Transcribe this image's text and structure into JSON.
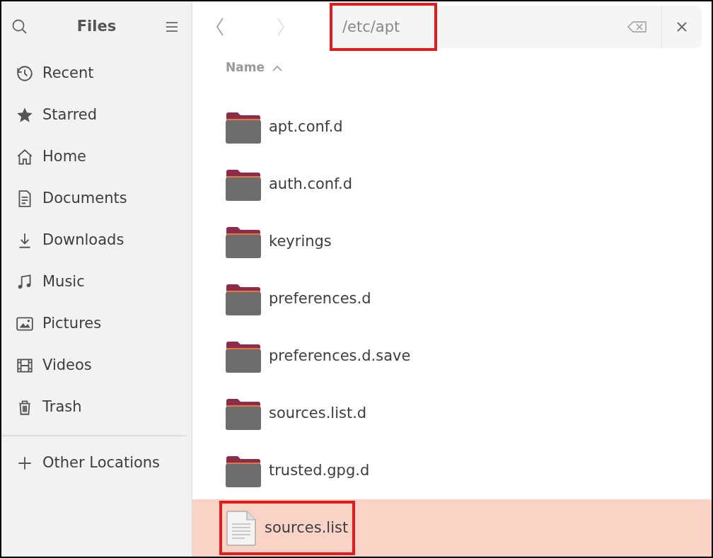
{
  "sidebar": {
    "title": "Files",
    "items": [
      {
        "label": "Recent"
      },
      {
        "label": "Starred"
      },
      {
        "label": "Home"
      },
      {
        "label": "Documents"
      },
      {
        "label": "Downloads"
      },
      {
        "label": "Music"
      },
      {
        "label": "Pictures"
      },
      {
        "label": "Videos"
      },
      {
        "label": "Trash"
      }
    ],
    "other": {
      "label": "Other Locations"
    }
  },
  "path_bar": {
    "value": "/etc/apt",
    "annotated": true
  },
  "column": {
    "label": "Name"
  },
  "files": [
    {
      "name": "apt.conf.d",
      "kind": "folder",
      "selected": false,
      "annotated": false
    },
    {
      "name": "auth.conf.d",
      "kind": "folder",
      "selected": false,
      "annotated": false
    },
    {
      "name": "keyrings",
      "kind": "folder",
      "selected": false,
      "annotated": false
    },
    {
      "name": "preferences.d",
      "kind": "folder",
      "selected": false,
      "annotated": false
    },
    {
      "name": "preferences.d.save",
      "kind": "folder",
      "selected": false,
      "annotated": false
    },
    {
      "name": "sources.list.d",
      "kind": "folder",
      "selected": false,
      "annotated": false
    },
    {
      "name": "trusted.gpg.d",
      "kind": "folder",
      "selected": false,
      "annotated": false
    },
    {
      "name": "sources.list",
      "kind": "file",
      "selected": true,
      "annotated": true
    }
  ]
}
